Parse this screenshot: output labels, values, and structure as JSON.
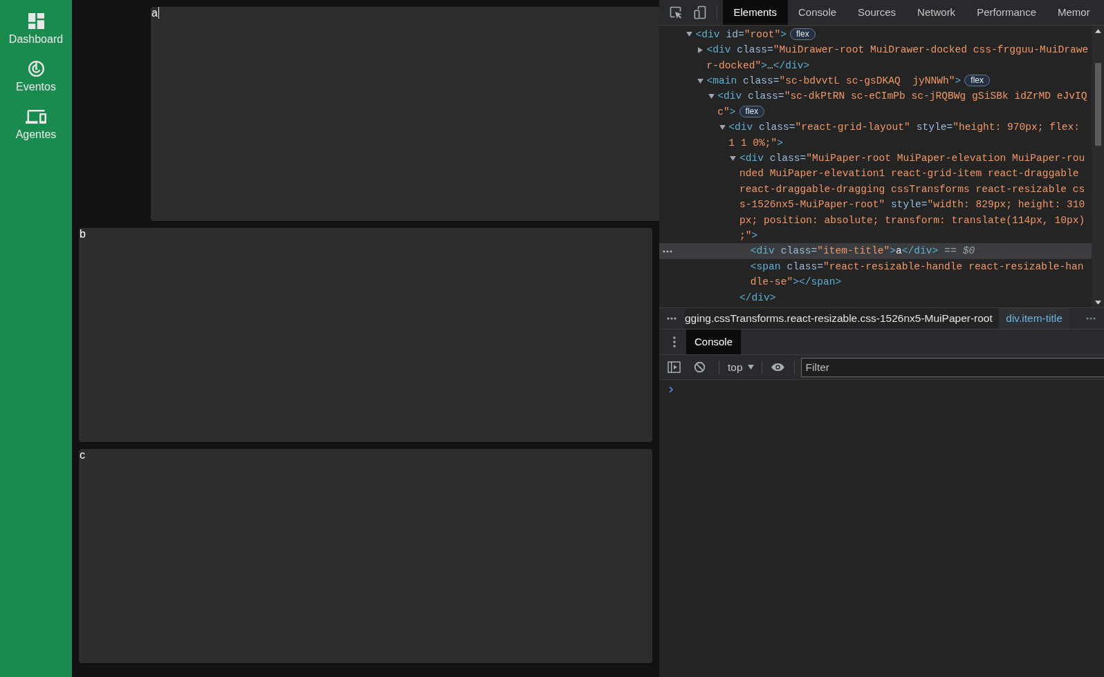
{
  "sidebar": {
    "items": [
      {
        "label": "Dashboard"
      },
      {
        "label": "Eventos"
      },
      {
        "label": "Agentes"
      }
    ]
  },
  "cards": [
    {
      "title": "a",
      "dragging": true
    },
    {
      "title": "b",
      "dragging": false
    },
    {
      "title": "c",
      "dragging": false
    }
  ],
  "devtools": {
    "tabs": [
      {
        "label": "Elements",
        "selected": true
      },
      {
        "label": "Console",
        "selected": false
      },
      {
        "label": "Sources",
        "selected": false
      },
      {
        "label": "Network",
        "selected": false
      },
      {
        "label": "Performance",
        "selected": false
      },
      {
        "label": "Memor",
        "selected": false
      }
    ],
    "dom_tree": [
      {
        "tokens": [
          {
            "kind": "tag",
            "text": "<div"
          },
          {
            "kind": "attr",
            "text": " id="
          },
          {
            "kind": "value",
            "text": "\"root\""
          },
          {
            "kind": "tag",
            "text": ">"
          }
        ],
        "badge": "flex",
        "expanded": true,
        "selected": false,
        "children": [
          {
            "tokens": [
              {
                "kind": "tag",
                "text": "<div"
              },
              {
                "kind": "attr",
                "text": " class="
              },
              {
                "kind": "value",
                "text": "\"MuiDrawer-root MuiDrawer-docked css-frgguu-MuiDrawer-docked\""
              },
              {
                "kind": "tag",
                "text": ">"
              },
              {
                "kind": "text",
                "text": "…"
              },
              {
                "kind": "tag",
                "text": "</div>"
              }
            ],
            "expanded": false,
            "selected": false
          },
          {
            "tokens": [
              {
                "kind": "tag",
                "text": "<main"
              },
              {
                "kind": "attr",
                "text": " class="
              },
              {
                "kind": "value",
                "text": "\"sc-bdvvtL sc-gsDKAQ  jyNNWh\""
              },
              {
                "kind": "tag",
                "text": ">"
              }
            ],
            "badge": "flex",
            "expanded": true,
            "selected": false,
            "children": [
              {
                "tokens": [
                  {
                    "kind": "tag",
                    "text": "<div"
                  },
                  {
                    "kind": "attr",
                    "text": " class="
                  },
                  {
                    "kind": "value",
                    "text": "\"sc-dkPtRN sc-eCImPb sc-jRQBWg gSiSBk idZrMD eJvIQc\""
                  },
                  {
                    "kind": "tag",
                    "text": ">"
                  }
                ],
                "badge": "flex",
                "expanded": true,
                "selected": false,
                "children": [
                  {
                    "tokens": [
                      {
                        "kind": "tag",
                        "text": "<div"
                      },
                      {
                        "kind": "attr",
                        "text": " class="
                      },
                      {
                        "kind": "value",
                        "text": "\"react-grid-layout\""
                      },
                      {
                        "kind": "attr",
                        "text": " style="
                      },
                      {
                        "kind": "value",
                        "text": "\"height: 970px; flex: 1 1 0%;\""
                      },
                      {
                        "kind": "tag",
                        "text": ">"
                      }
                    ],
                    "expanded": true,
                    "selected": false,
                    "children": [
                      {
                        "tokens": [
                          {
                            "kind": "tag",
                            "text": "<div"
                          },
                          {
                            "kind": "attr",
                            "text": " class="
                          },
                          {
                            "kind": "value",
                            "text": "\"MuiPaper-root MuiPaper-elevation MuiPaper-rounded MuiPaper-elevation1 react-grid-item react-draggable react-draggable-dragging cssTransforms react-resizable css-1526nx5-MuiPaper-root\""
                          },
                          {
                            "kind": "attr",
                            "text": " style="
                          },
                          {
                            "kind": "value",
                            "text": "\"width: 829px; height: 310px; position: absolute; transform: translate(114px, 10px);\""
                          },
                          {
                            "kind": "tag",
                            "text": ">"
                          }
                        ],
                        "expanded": true,
                        "selected": false,
                        "close_tag": "</div>",
                        "children": [
                          {
                            "tokens": [
                              {
                                "kind": "tag",
                                "text": "<div"
                              },
                              {
                                "kind": "attr",
                                "text": " class="
                              },
                              {
                                "kind": "value",
                                "text": "\"item-title\""
                              },
                              {
                                "kind": "tag",
                                "text": ">"
                              },
                              {
                                "kind": "text",
                                "text": "a"
                              },
                              {
                                "kind": "tag",
                                "text": "</div>"
                              }
                            ],
                            "note": "== $0",
                            "selected": true
                          },
                          {
                            "tokens": [
                              {
                                "kind": "tag",
                                "text": "<span"
                              },
                              {
                                "kind": "attr",
                                "text": " class="
                              },
                              {
                                "kind": "value",
                                "text": "\"react-resizable-handle react-resizable-handle-se\""
                              },
                              {
                                "kind": "tag",
                                "text": "></span>"
                              }
                            ],
                            "selected": false
                          }
                        ]
                      }
                    ]
                  }
                ]
              }
            ]
          }
        ]
      }
    ],
    "breadcrumbs": [
      {
        "label": "gging.cssTransforms.react-resizable.css-1526nx5-MuiPaper-root",
        "selected": false
      },
      {
        "label": "div.item-title",
        "selected": true
      }
    ],
    "drawer_tabs": [
      {
        "label": "Console",
        "selected": true
      }
    ],
    "console": {
      "context_selector": {
        "value": "top"
      },
      "filter": {
        "placeholder": "Filter"
      }
    }
  }
}
